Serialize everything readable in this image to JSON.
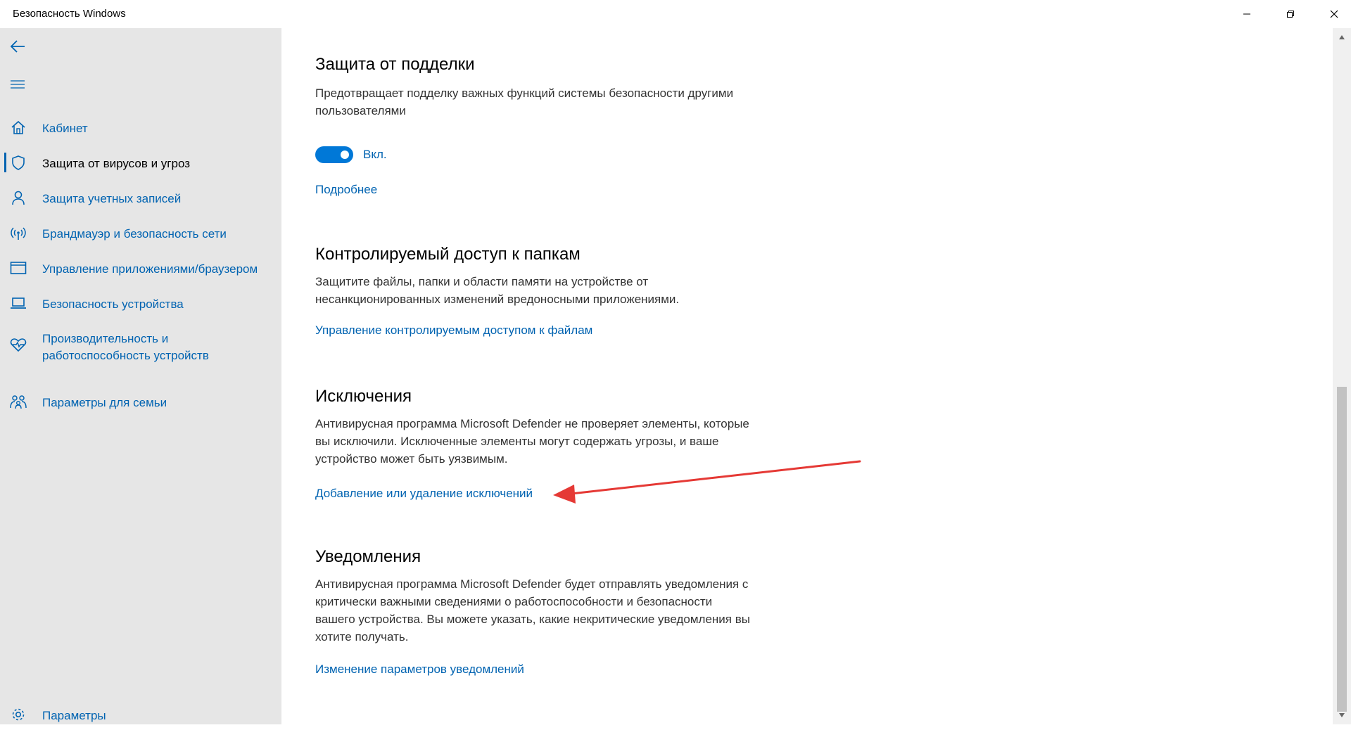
{
  "window": {
    "title": "Безопасность Windows"
  },
  "sidebar": {
    "items": [
      {
        "label": "Кабинет",
        "icon": "home-icon"
      },
      {
        "label": "Защита от вирусов и угроз",
        "icon": "shield-icon",
        "active": true
      },
      {
        "label": "Защита учетных записей",
        "icon": "person-icon"
      },
      {
        "label": "Брандмауэр и безопасность сети",
        "icon": "wireless-icon"
      },
      {
        "label": "Управление приложениями/браузером",
        "icon": "app-window-icon"
      },
      {
        "label": "Безопасность устройства",
        "icon": "laptop-icon"
      },
      {
        "label": "Производительность и работоспособность устройств",
        "icon": "heart-pulse-icon"
      },
      {
        "label": "Параметры для семьи",
        "icon": "family-icon"
      }
    ],
    "settings_label": "Параметры"
  },
  "main": {
    "tamper": {
      "title": "Защита от подделки",
      "description": "Предотвращает подделку важных функций системы безопасности другими пользователями",
      "toggle_label": "Вкл.",
      "toggle_on": true,
      "link": "Подробнее"
    },
    "folders": {
      "title": "Контролируемый доступ к папкам",
      "description": "Защитите файлы, папки и области памяти на устройстве от несанкционированных изменений вредоносными приложениями.",
      "link": "Управление контролируемым доступом к файлам"
    },
    "exclusions": {
      "title": "Исключения",
      "description": "Антивирусная программа Microsoft Defender не проверяет элементы, которые вы исключили. Исключенные элементы могут содержать угрозы, и ваше устройство может быть уязвимым.",
      "link": "Добавление или удаление исключений"
    },
    "notifications": {
      "title": "Уведомления",
      "description": "Антивирусная программа Microsoft Defender будет отправлять уведомления с критически важными сведениями о работоспособности и безопасности вашего устройства. Вы можете указать, какие некритические уведомления вы хотите получать.",
      "link": "Изменение параметров уведомлений"
    }
  },
  "colors": {
    "accent": "#0063b1",
    "toggle": "#0078d7",
    "sidebar_bg": "#e6e6e6",
    "annotation_arrow": "#e53935"
  }
}
